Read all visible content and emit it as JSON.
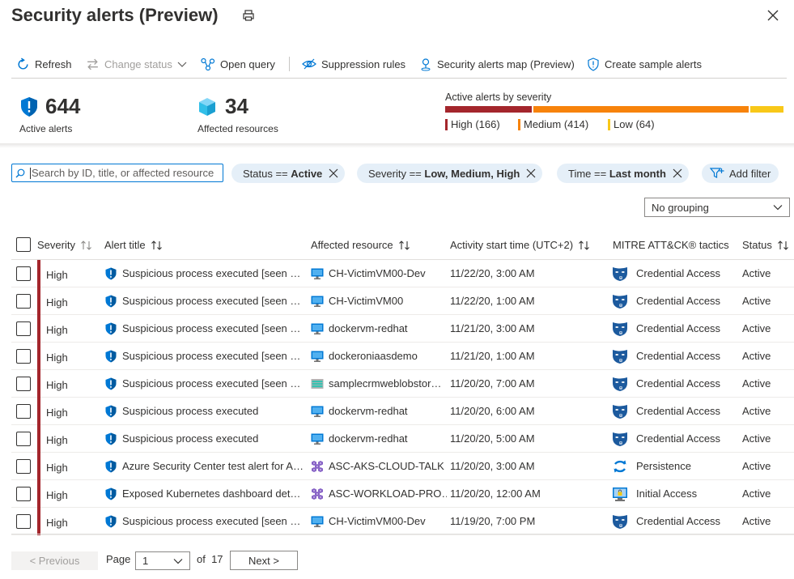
{
  "title": "Security alerts (Preview)",
  "toolbar": {
    "refresh": "Refresh",
    "change_status": "Change status",
    "open_query": "Open query",
    "suppression_rules": "Suppression rules",
    "alerts_map": "Security alerts map (Preview)",
    "sample_alerts": "Create sample alerts"
  },
  "summary": {
    "active_alerts_count": "644",
    "active_alerts_label": "Active alerts",
    "affected_resources_count": "34",
    "affected_resources_label": "Affected resources",
    "severity_title": "Active alerts by severity",
    "severity": [
      {
        "label": "High (166)",
        "value": 166,
        "color": "#a4262c"
      },
      {
        "label": "Medium (414)",
        "value": 414,
        "color": "#f7830b"
      },
      {
        "label": "Low (64)",
        "value": 64,
        "color": "#f8c819"
      }
    ]
  },
  "filters": {
    "search_placeholder": "Search by ID, title, or affected resource",
    "status_key": "Status == ",
    "status_value": "Active",
    "severity_key": "Severity == ",
    "severity_value": "Low, Medium, High",
    "time_key": "Time == ",
    "time_value": "Last month",
    "add_filter": "Add filter",
    "grouping": "No grouping"
  },
  "table": {
    "headers": {
      "severity": "Severity",
      "alert_title": "Alert title",
      "affected_resource": "Affected resource",
      "activity_start": "Activity start time (UTC+2)",
      "tactics": "MITRE ATT&CK® tactics",
      "status": "Status"
    },
    "rows": [
      {
        "severity": "High",
        "title": "Suspicious process executed [seen …",
        "resource": "CH-VictimVM00-Dev",
        "resource_type": "vm",
        "time": "11/22/20, 3:00 AM",
        "tactic": "Credential Access",
        "tactic_type": "credential",
        "status": "Active"
      },
      {
        "severity": "High",
        "title": "Suspicious process executed [seen …",
        "resource": "CH-VictimVM00",
        "resource_type": "vm",
        "time": "11/22/20, 1:00 AM",
        "tactic": "Credential Access",
        "tactic_type": "credential",
        "status": "Active"
      },
      {
        "severity": "High",
        "title": "Suspicious process executed [seen …",
        "resource": "dockervm-redhat",
        "resource_type": "vm",
        "time": "11/21/20, 3:00 AM",
        "tactic": "Credential Access",
        "tactic_type": "credential",
        "status": "Active"
      },
      {
        "severity": "High",
        "title": "Suspicious process executed [seen …",
        "resource": "dockeroniaasdemo",
        "resource_type": "vm",
        "time": "11/21/20, 1:00 AM",
        "tactic": "Credential Access",
        "tactic_type": "credential",
        "status": "Active"
      },
      {
        "severity": "High",
        "title": "Suspicious process executed [seen …",
        "resource": "samplecrmweblobstor…",
        "resource_type": "storage",
        "time": "11/20/20, 7:00 AM",
        "tactic": "Credential Access",
        "tactic_type": "credential",
        "status": "Active"
      },
      {
        "severity": "High",
        "title": "Suspicious process executed",
        "resource": "dockervm-redhat",
        "resource_type": "vm",
        "time": "11/20/20, 6:00 AM",
        "tactic": "Credential Access",
        "tactic_type": "credential",
        "status": "Active"
      },
      {
        "severity": "High",
        "title": "Suspicious process executed",
        "resource": "dockervm-redhat",
        "resource_type": "vm",
        "time": "11/20/20, 5:00 AM",
        "tactic": "Credential Access",
        "tactic_type": "credential",
        "status": "Active"
      },
      {
        "severity": "High",
        "title": "Azure Security Center test alert for A…",
        "resource": "ASC-AKS-CLOUD-TALK",
        "resource_type": "aks",
        "time": "11/20/20, 3:00 AM",
        "tactic": "Persistence",
        "tactic_type": "persistence",
        "status": "Active"
      },
      {
        "severity": "High",
        "title": "Exposed Kubernetes dashboard det…",
        "resource": "ASC-WORKLOAD-PRO…",
        "resource_type": "aks",
        "time": "11/20/20, 12:00 AM",
        "tactic": "Initial Access",
        "tactic_type": "initial",
        "status": "Active"
      },
      {
        "severity": "High",
        "title": "Suspicious process executed [seen …",
        "resource": "CH-VictimVM00-Dev",
        "resource_type": "vm",
        "time": "11/19/20, 7:00 PM",
        "tactic": "Credential Access",
        "tactic_type": "credential",
        "status": "Active"
      }
    ]
  },
  "pagination": {
    "previous": "< Previous",
    "page_label": "Page",
    "current_page": "1",
    "of_label": "of",
    "total_pages": "17",
    "next": "Next >"
  }
}
